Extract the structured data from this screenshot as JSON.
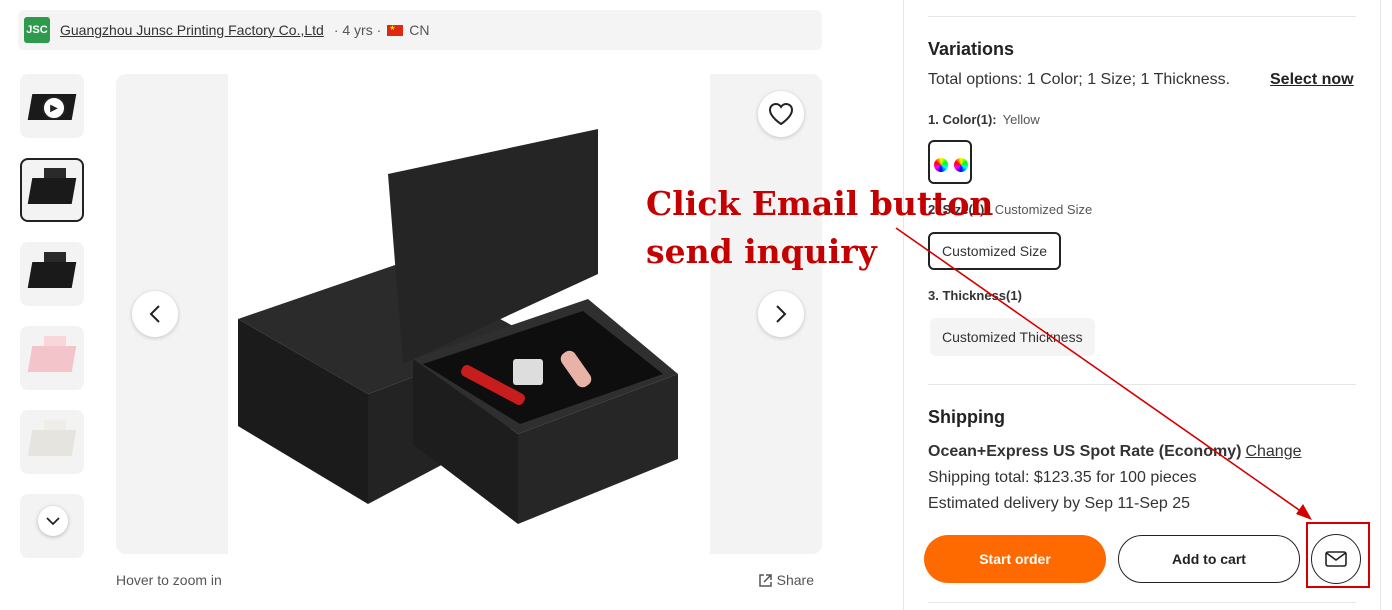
{
  "supplier": {
    "logo_text": "JSC",
    "name": "Guangzhou Junsc Printing Factory Co.,Ltd",
    "years": "· 4 yrs ·",
    "country": "CN"
  },
  "gallery": {
    "hover_hint": "Hover to zoom in",
    "share_label": "Share"
  },
  "annotation": {
    "line1": "Click Email button",
    "line2": "send inquiry",
    "color": "#c40000"
  },
  "variations": {
    "title": "Variations",
    "total": "Total options: 1 Color; 1 Size; 1 Thickness.",
    "select_now": "Select now",
    "color_label": "1. Color(1):",
    "color_value": "Yellow",
    "size_label": "2. Size(1):",
    "size_value": "Customized Size",
    "size_chip": "Customized Size",
    "thickness_label": "3. Thickness(1)",
    "thickness_chip": "Customized Thickness"
  },
  "shipping": {
    "title": "Shipping",
    "method": "Ocean+Express US Spot Rate (Economy)",
    "change": "Change",
    "total": "Shipping total: $123.35 for 100 pieces",
    "delivery": "Estimated delivery by Sep 11-Sep 25"
  },
  "actions": {
    "start_order": "Start order",
    "add_to_cart": "Add to cart",
    "accent": "#ff6a00"
  }
}
